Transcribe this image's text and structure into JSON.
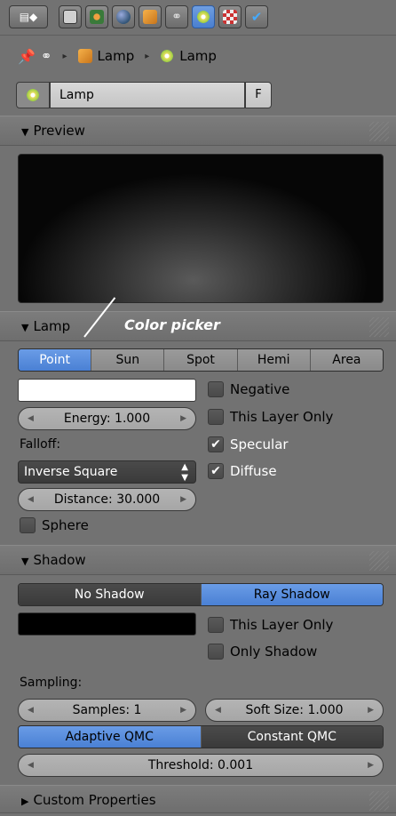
{
  "header": {
    "tabs": [
      {
        "icon": "render-icon"
      },
      {
        "icon": "scene-icon"
      },
      {
        "icon": "world-icon"
      },
      {
        "icon": "object-icon"
      },
      {
        "icon": "constraints-icon"
      },
      {
        "icon": "lamp-data-icon",
        "active": true
      },
      {
        "icon": "texture-icon"
      },
      {
        "icon": "physics-icon"
      }
    ]
  },
  "breadcrumb": {
    "items": [
      "Lamp",
      "Lamp"
    ]
  },
  "datablock": {
    "name": "Lamp",
    "fake_user": "F"
  },
  "preview": {
    "title": "Preview"
  },
  "lamp": {
    "title": "Lamp",
    "types": [
      "Point",
      "Sun",
      "Spot",
      "Hemi",
      "Area"
    ],
    "selected_type": "Point",
    "energy": "Energy: 1.000",
    "falloff_label": "Falloff:",
    "falloff_value": "Inverse Square",
    "distance": "Distance: 30.000",
    "sphere": "Sphere",
    "negative": "Negative",
    "this_layer_only": "This Layer Only",
    "specular": "Specular",
    "diffuse": "Diffuse",
    "color": "#ffffff"
  },
  "annotation": {
    "text": "Color picker"
  },
  "shadow": {
    "title": "Shadow",
    "modes": [
      "No Shadow",
      "Ray Shadow"
    ],
    "selected": "Ray Shadow",
    "color": "#000000",
    "this_layer_only": "This Layer Only",
    "only_shadow": "Only Shadow",
    "sampling_label": "Sampling:",
    "samples": "Samples: 1",
    "soft_size": "Soft Size: 1.000",
    "qmc": [
      "Adaptive QMC",
      "Constant QMC"
    ],
    "qmc_selected": "Adaptive QMC",
    "threshold": "Threshold: 0.001"
  },
  "custom": {
    "title": "Custom Properties"
  }
}
